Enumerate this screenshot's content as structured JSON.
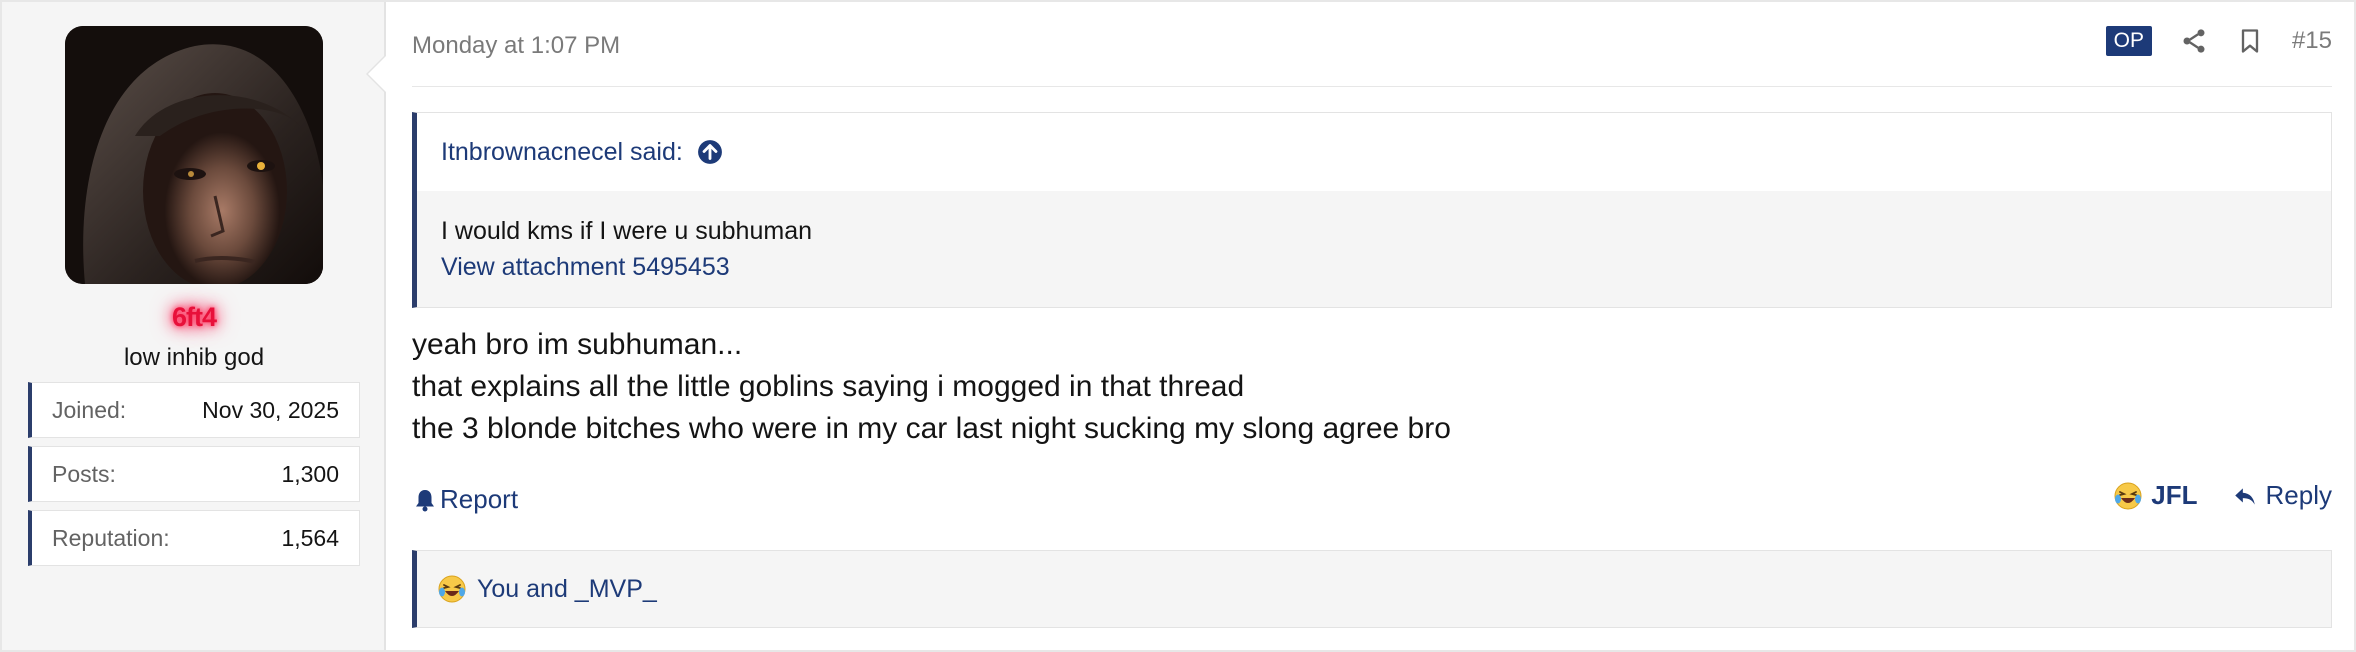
{
  "user": {
    "name": "6ft4",
    "title": "low inhib god",
    "stats": [
      {
        "label": "Joined:",
        "value": "Nov 30, 2025"
      },
      {
        "label": "Posts:",
        "value": "1,300"
      },
      {
        "label": "Reputation:",
        "value": "1,564"
      }
    ]
  },
  "post": {
    "date": "Monday at 1:07 PM",
    "op_badge": "OP",
    "number": "#15",
    "quote": {
      "author_line": "Itnbrownacnecel said:",
      "text": "I would kms if I were u subhuman",
      "attachment_link": "View attachment 5495453"
    },
    "body": [
      "yeah bro im subhuman...",
      "that explains all the little goblins saying i mogged in that thread",
      "the 3 blonde bitches who were in my car last night sucking my slong agree bro"
    ],
    "actions": {
      "report": "Report",
      "react": "JFL",
      "reply": "Reply"
    },
    "reactions_summary": "You and _MVP_"
  },
  "colors": {
    "accent": "#1d3a78",
    "username": "#e8103a",
    "sidebar_bg": "#f5f5f5"
  },
  "icons": [
    "share-icon",
    "bookmark-icon",
    "arrow-up-circle-icon",
    "bell-icon",
    "reply-arrow-icon",
    "laughing-crying-emoji-icon"
  ]
}
